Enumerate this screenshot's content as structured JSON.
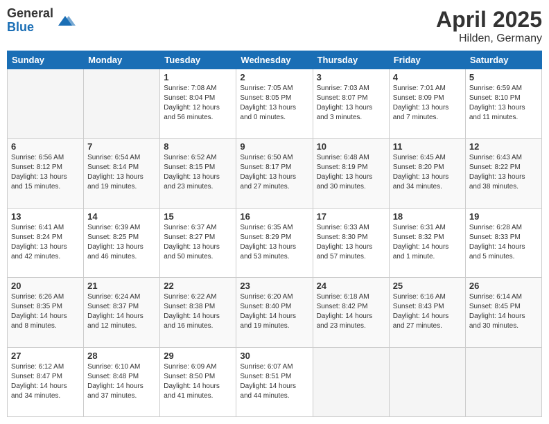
{
  "logo": {
    "general": "General",
    "blue": "Blue"
  },
  "title": {
    "month": "April 2025",
    "location": "Hilden, Germany"
  },
  "weekdays": [
    "Sunday",
    "Monday",
    "Tuesday",
    "Wednesday",
    "Thursday",
    "Friday",
    "Saturday"
  ],
  "weeks": [
    [
      {
        "day": "",
        "info": ""
      },
      {
        "day": "",
        "info": ""
      },
      {
        "day": "1",
        "info": "Sunrise: 7:08 AM\nSunset: 8:04 PM\nDaylight: 12 hours\nand 56 minutes."
      },
      {
        "day": "2",
        "info": "Sunrise: 7:05 AM\nSunset: 8:05 PM\nDaylight: 13 hours\nand 0 minutes."
      },
      {
        "day": "3",
        "info": "Sunrise: 7:03 AM\nSunset: 8:07 PM\nDaylight: 13 hours\nand 3 minutes."
      },
      {
        "day": "4",
        "info": "Sunrise: 7:01 AM\nSunset: 8:09 PM\nDaylight: 13 hours\nand 7 minutes."
      },
      {
        "day": "5",
        "info": "Sunrise: 6:59 AM\nSunset: 8:10 PM\nDaylight: 13 hours\nand 11 minutes."
      }
    ],
    [
      {
        "day": "6",
        "info": "Sunrise: 6:56 AM\nSunset: 8:12 PM\nDaylight: 13 hours\nand 15 minutes."
      },
      {
        "day": "7",
        "info": "Sunrise: 6:54 AM\nSunset: 8:14 PM\nDaylight: 13 hours\nand 19 minutes."
      },
      {
        "day": "8",
        "info": "Sunrise: 6:52 AM\nSunset: 8:15 PM\nDaylight: 13 hours\nand 23 minutes."
      },
      {
        "day": "9",
        "info": "Sunrise: 6:50 AM\nSunset: 8:17 PM\nDaylight: 13 hours\nand 27 minutes."
      },
      {
        "day": "10",
        "info": "Sunrise: 6:48 AM\nSunset: 8:19 PM\nDaylight: 13 hours\nand 30 minutes."
      },
      {
        "day": "11",
        "info": "Sunrise: 6:45 AM\nSunset: 8:20 PM\nDaylight: 13 hours\nand 34 minutes."
      },
      {
        "day": "12",
        "info": "Sunrise: 6:43 AM\nSunset: 8:22 PM\nDaylight: 13 hours\nand 38 minutes."
      }
    ],
    [
      {
        "day": "13",
        "info": "Sunrise: 6:41 AM\nSunset: 8:24 PM\nDaylight: 13 hours\nand 42 minutes."
      },
      {
        "day": "14",
        "info": "Sunrise: 6:39 AM\nSunset: 8:25 PM\nDaylight: 13 hours\nand 46 minutes."
      },
      {
        "day": "15",
        "info": "Sunrise: 6:37 AM\nSunset: 8:27 PM\nDaylight: 13 hours\nand 50 minutes."
      },
      {
        "day": "16",
        "info": "Sunrise: 6:35 AM\nSunset: 8:29 PM\nDaylight: 13 hours\nand 53 minutes."
      },
      {
        "day": "17",
        "info": "Sunrise: 6:33 AM\nSunset: 8:30 PM\nDaylight: 13 hours\nand 57 minutes."
      },
      {
        "day": "18",
        "info": "Sunrise: 6:31 AM\nSunset: 8:32 PM\nDaylight: 14 hours\nand 1 minute."
      },
      {
        "day": "19",
        "info": "Sunrise: 6:28 AM\nSunset: 8:33 PM\nDaylight: 14 hours\nand 5 minutes."
      }
    ],
    [
      {
        "day": "20",
        "info": "Sunrise: 6:26 AM\nSunset: 8:35 PM\nDaylight: 14 hours\nand 8 minutes."
      },
      {
        "day": "21",
        "info": "Sunrise: 6:24 AM\nSunset: 8:37 PM\nDaylight: 14 hours\nand 12 minutes."
      },
      {
        "day": "22",
        "info": "Sunrise: 6:22 AM\nSunset: 8:38 PM\nDaylight: 14 hours\nand 16 minutes."
      },
      {
        "day": "23",
        "info": "Sunrise: 6:20 AM\nSunset: 8:40 PM\nDaylight: 14 hours\nand 19 minutes."
      },
      {
        "day": "24",
        "info": "Sunrise: 6:18 AM\nSunset: 8:42 PM\nDaylight: 14 hours\nand 23 minutes."
      },
      {
        "day": "25",
        "info": "Sunrise: 6:16 AM\nSunset: 8:43 PM\nDaylight: 14 hours\nand 27 minutes."
      },
      {
        "day": "26",
        "info": "Sunrise: 6:14 AM\nSunset: 8:45 PM\nDaylight: 14 hours\nand 30 minutes."
      }
    ],
    [
      {
        "day": "27",
        "info": "Sunrise: 6:12 AM\nSunset: 8:47 PM\nDaylight: 14 hours\nand 34 minutes."
      },
      {
        "day": "28",
        "info": "Sunrise: 6:10 AM\nSunset: 8:48 PM\nDaylight: 14 hours\nand 37 minutes."
      },
      {
        "day": "29",
        "info": "Sunrise: 6:09 AM\nSunset: 8:50 PM\nDaylight: 14 hours\nand 41 minutes."
      },
      {
        "day": "30",
        "info": "Sunrise: 6:07 AM\nSunset: 8:51 PM\nDaylight: 14 hours\nand 44 minutes."
      },
      {
        "day": "",
        "info": ""
      },
      {
        "day": "",
        "info": ""
      },
      {
        "day": "",
        "info": ""
      }
    ]
  ]
}
